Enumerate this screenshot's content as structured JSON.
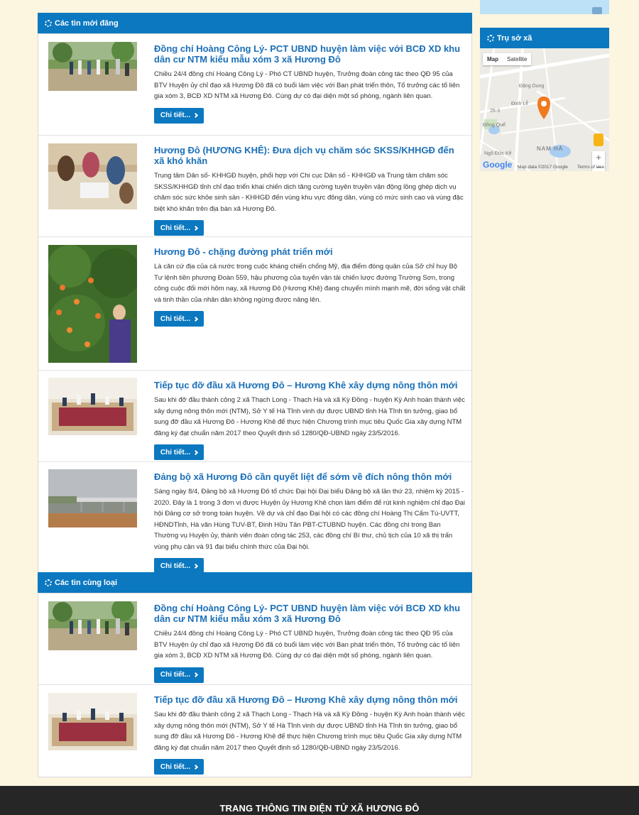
{
  "sections": {
    "latest_title": "Các tin mới đăng",
    "related_title": "Các tin cùng loại"
  },
  "more_label": "Chi tiết...",
  "latest": [
    {
      "title": "Đồng chí Hoàng Công Lý- PCT UBND huyện làm việc với BCĐ XD khu dân cư NTM kiểu mẫu xóm 3 xã Hương Đô",
      "summary": "Chiều 24/4 đồng chí Hoàng Công Lý - Phó CT UBND huyện, Trưởng đoàn công tác theo QĐ 95 của BTV Huyện ủy chỉ đạo xã Hương Đô đã có buổi làm việc với Ban phát triển thôn, Tổ trưởng các tổ liên gia xóm 3, BCĐ XD NTM xã Hương Đô. Cùng dự có đại diện một số phòng, ngành liên quan."
    },
    {
      "title": "Hương Đô (HƯƠNG KHÊ): Đưa dịch vụ chăm sóc SKSS/KHHGĐ đến xã khó khăn",
      "summary": "Trung tâm Dân số- KHHGĐ huyện, phối hợp với Chi cục Dân số - KHHGĐ và Trung tâm chăm sóc SKSS/KHHGĐ tỉnh chỉ đạo triển khai chiến dịch tăng cường tuyên truyền vận động lồng ghép dịch vụ chăm sóc sức khỏe sinh sản - KHHGĐ đến vùng khu vực đông dân, vùng có mức sinh cao và vùng đặc biệt khó khăn trên địa bàn xã Hương Đô."
    },
    {
      "title": "Hương Đô - chặng đường phát triển mới",
      "summary": "Là căn cứ địa của cả nước trong cuộc kháng chiến chống Mỹ, địa điểm đóng quân của Sở chỉ huy Bộ Tư lệnh tiền phương Đoàn 559, hậu phương của tuyến vận tải chiến lược đường Trường Sơn, trong công cuộc đổi mới hôm nay, xã Hương Đô (Hương Khê) đang chuyển mình mạnh mẽ, đời sống vật chất và tinh thần của nhân dân không ngừng được nâng lên."
    },
    {
      "title": "Tiếp tục đỡ đầu xã Hương Đô – Hương Khê xây dựng nông thôn mới",
      "summary": "Sau khi đỡ đầu thành công 2 xã Thạch Long - Thạch Hà và xã Kỳ Đồng - huyện Kỳ Anh hoàn thành việc xây dựng nông thôn mới (NTM), Sở Y tế Hà Tĩnh vinh dự được UBND tỉnh Hà Tĩnh tin tưởng, giao bổ sung đỡ đầu xã Hương Đô - Hương Khê để thực hiện Chương trình mục tiêu Quốc Gia xây dựng NTM đăng ký đạt chuẩn năm 2017 theo Quyết định số 1280/QĐ-UBND ngày 23/5/2016."
    },
    {
      "title": "Đảng bộ xã Hương Đô cần quyết liệt để sớm về đích nông thôn mới",
      "summary": "Sáng ngày 8/4, Đảng bộ xã Hương Đô tổ chức Đại hội Đại biểu Đảng bộ xã lần thứ 23, nhiệm kỳ 2015 - 2020. Đây là 1 trong 3 đơn vị được Huyện ủy Hương Khê chọn làm điểm để rút kinh nghiệm chỉ đạo Đại hội Đảng cơ sở trong toàn huyện. Về dự và chỉ đạo Đại hội có các đồng chí Hoàng Thị Cẩm Tú-UVTT, HĐNDTỉnh, Hà văn Hùng TUV-BT, Đinh Hữu Tân PBT-CTUBND huyện. Các đồng chí trong Ban Thường vụ Huyện ủy, thành viên đoàn công tác 253, các đồng chí Bí thư, chủ tịch của 10 xã thị trấn vùng phụ cận và 91 đại biểu chính thức của Đại hội."
    }
  ],
  "related": [
    {
      "title": "Đồng chí Hoàng Công Lý- PCT UBND huyện làm việc với BCĐ XD khu dân cư NTM kiểu mẫu xóm 3 xã Hương Đô",
      "summary": "Chiều 24/4 đồng chí Hoàng Công Lý - Phó CT UBND huyện, Trưởng đoàn công tác theo QĐ 95 của BTV Huyện ủy chỉ đạo xã Hương Đô đã có buổi làm việc với Ban phát triển thôn, Tổ trưởng các tổ liên gia xóm 3, BCĐ XD NTM xã Hương Đô. Cùng dự có đại diện một số phòng, ngành liên quan."
    },
    {
      "title": "Tiếp tục đỡ đầu xã Hương Đô – Hương Khê xây dựng nông thôn mới",
      "summary": "Sau khi đỡ đầu thành công 2 xã Thạch Long - Thạch Hà và xã Kỳ Đồng - huyện Kỳ Anh hoàn thành việc xây dựng nông thôn mới (NTM), Sở Y tế Hà Tĩnh vinh dự được UBND tỉnh Hà Tĩnh tin tưởng, giao bổ sung đỡ đầu xã Hương Đô - Hương Khê để thực hiện Chương trình mục tiêu Quốc Gia xây dựng NTM đăng ký đạt chuẩn năm 2017 theo Quyết định số 1280/QĐ-UBND ngày 23/5/2016."
    }
  ],
  "sidebar": {
    "office_title": "Trụ sở xã",
    "map": {
      "tab_map": "Map",
      "tab_satellite": "Satellite",
      "label_dang_dung": "Đặng Dung",
      "label_nam_ha": "NAM HÀ",
      "label_road": "26-3",
      "label_dinh_le": "Đinh Lễ",
      "label_dong_que": "Đồng Quế",
      "label_ngo_duc_ke": "Ngô Đức Kế",
      "google": "Google",
      "attribution": "Map data ©2017 Google",
      "terms": "Terms of Use",
      "zoom_in": "+",
      "zoom_out": "−"
    }
  },
  "footer": {
    "title": "TRANG THÔNG TIN ĐIỆN TỬ XÃ HƯƠNG ĐÔ"
  },
  "colors": {
    "accent": "#0b78c0",
    "title_link": "#1a6fb8",
    "page_bg": "#fcf5e0",
    "footer_bg": "#262626"
  }
}
